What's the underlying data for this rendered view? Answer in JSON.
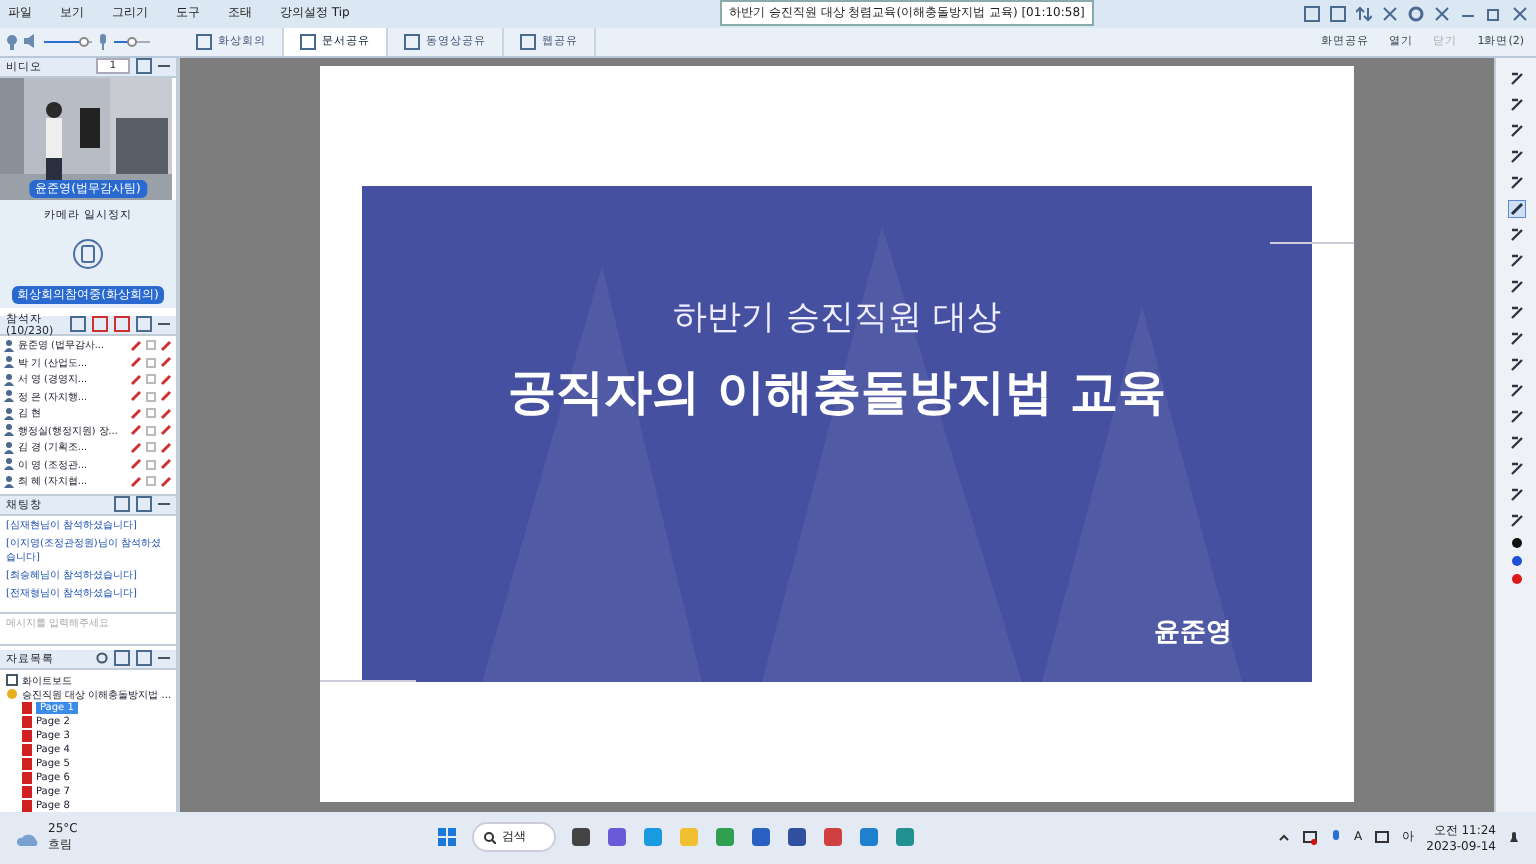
{
  "menu": [
    "파일",
    "보기",
    "그리기",
    "도구",
    "조태",
    "강의설정 Tip"
  ],
  "window": {
    "title": "하반기 승진직원 대상 청렴교육(이해충돌방지법 교육) [01:10:58]"
  },
  "volume": {
    "level": 0.9
  },
  "mic": {
    "level": 0.5
  },
  "tabs": [
    {
      "label": "화상회의",
      "selected": false
    },
    {
      "label": "문서공유",
      "selected": true
    },
    {
      "label": "동영상공유",
      "selected": false
    },
    {
      "label": "웹공유",
      "selected": false
    }
  ],
  "actions": [
    {
      "label": "화면공유",
      "disabled": false
    },
    {
      "label": "열기",
      "disabled": false
    },
    {
      "label": "닫기",
      "disabled": true
    },
    {
      "label": "1화면(2)",
      "disabled": false
    }
  ],
  "video": {
    "title": "비디오",
    "camera": "1",
    "caption": "윤준영(법무감사팀)",
    "paused": "카메라 일시정지",
    "paused_caption": "회상회의참여중(화상회의)"
  },
  "participants": {
    "title": "참석자 (10/230)",
    "rows": [
      {
        "name": "윤준영 (법무감사..."
      },
      {
        "name": "박  기 (산업도..."
      },
      {
        "name": "서  영 (경영지..."
      },
      {
        "name": "정  은 (자치행..."
      },
      {
        "name": "김  현"
      },
      {
        "name": "행정실(행정지원) 장..."
      },
      {
        "name": "김  경 (기획조..."
      },
      {
        "name": "이  영 (조정관..."
      },
      {
        "name": "최  혜 (자치협..."
      }
    ]
  },
  "chat": {
    "title": "채팅창",
    "messages": [
      "[심재현님이 참석하셨습니다]",
      "[이지영(조정관정원)님이 참석하셨습니다]",
      "[최승혜님이 참석하셨습니다]",
      "[전재형님이 참석하셨습니다]"
    ],
    "placeholder": "메시지를 입력해주세요"
  },
  "materials": {
    "title": "자료목록",
    "tree": [
      {
        "label": "화이트보드",
        "expanded": false
      },
      {
        "label": "승진직원 대상 이해충돌방지법 ...",
        "expanded": true,
        "children": [
          {
            "label": "Page 1",
            "selected": true
          },
          {
            "label": "Page 2",
            "selected": false
          },
          {
            "label": "Page 3",
            "selected": false
          },
          {
            "label": "Page 4",
            "selected": false
          },
          {
            "label": "Page 5",
            "selected": false
          },
          {
            "label": "Page 6",
            "selected": false
          },
          {
            "label": "Page 7",
            "selected": false
          },
          {
            "label": "Page 8",
            "selected": false
          }
        ]
      }
    ]
  },
  "slide": {
    "subtitle": "하반기 승진직원 대상",
    "title": "공직자의 이해충돌방지법 교육",
    "presenter": "윤준영"
  },
  "pen_colors": [
    {
      "color": "#111111",
      "selected": false
    },
    {
      "color": "#1e4fd8",
      "selected": false
    },
    {
      "color": "#e01818",
      "selected": false
    }
  ],
  "taskbar": {
    "weather_temp": "25°C",
    "weather_text": "흐림",
    "search": "검색",
    "ime": "A",
    "lang": "아",
    "time": "오전 11:24",
    "date": "2023-09-14"
  }
}
